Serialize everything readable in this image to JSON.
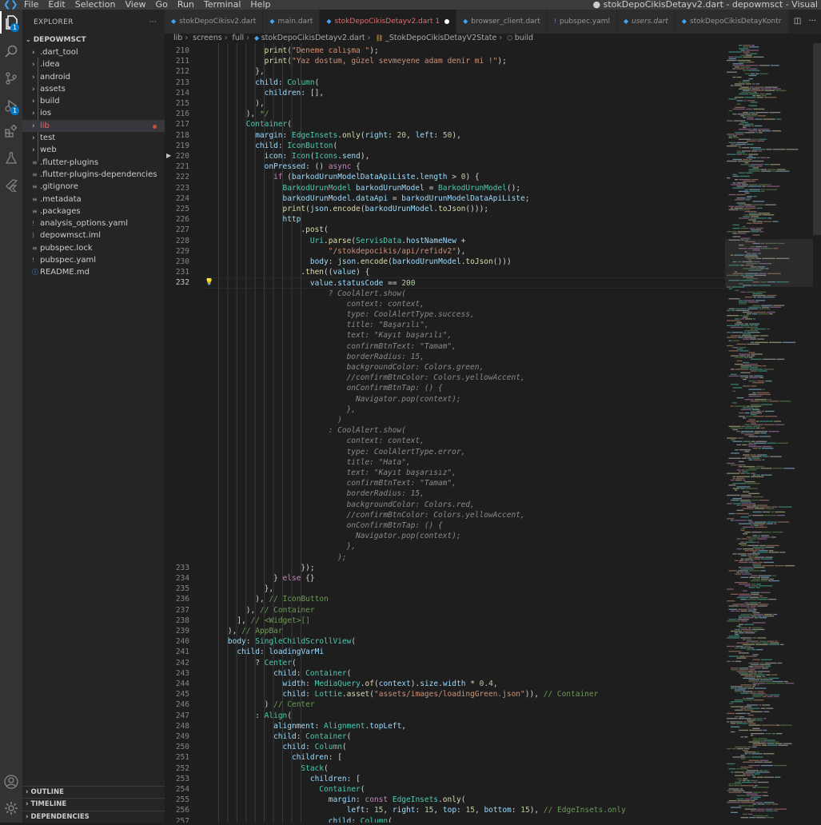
{
  "window": {
    "title": "● stokDepoCikisDetayv2.dart - depowmsct - Visual"
  },
  "menu": [
    "File",
    "Edit",
    "Selection",
    "View",
    "Go",
    "Run",
    "Terminal",
    "Help"
  ],
  "activity_bar": {
    "explorer_badge": "1",
    "run_badge": "1"
  },
  "explorer": {
    "title": "EXPLORER",
    "more": "···",
    "project": "DEPOWMSCT",
    "items": [
      {
        "label": ".dart_tool",
        "type": "folder"
      },
      {
        "label": ".idea",
        "type": "folder"
      },
      {
        "label": "android",
        "type": "folder"
      },
      {
        "label": "assets",
        "type": "folder"
      },
      {
        "label": "build",
        "type": "folder"
      },
      {
        "label": "ios",
        "type": "folder"
      },
      {
        "label": "lib",
        "type": "folder"
      },
      {
        "label": "test",
        "type": "folder"
      },
      {
        "label": "web",
        "type": "folder"
      },
      {
        "label": ".flutter-plugins",
        "type": "file"
      },
      {
        "label": ".flutter-plugins-dependencies",
        "type": "file"
      },
      {
        "label": ".gitignore",
        "type": "file"
      },
      {
        "label": ".metadata",
        "type": "file"
      },
      {
        "label": ".packages",
        "type": "file"
      },
      {
        "label": "analysis_options.yaml",
        "type": "yaml"
      },
      {
        "label": "depowmsct.iml",
        "type": "rss"
      },
      {
        "label": "pubspec.lock",
        "type": "file"
      },
      {
        "label": "pubspec.yaml",
        "type": "yaml"
      },
      {
        "label": "README.md",
        "type": "info"
      }
    ],
    "panels": [
      "OUTLINE",
      "TIMELINE",
      "DEPENDENCIES"
    ]
  },
  "tabs": [
    {
      "label": "stokDepoCikisv2.dart",
      "active": false,
      "italic": false
    },
    {
      "label": "main.dart",
      "active": false,
      "italic": false
    },
    {
      "label": "stokDepoCikisDetayv2.dart 1",
      "active": true,
      "italic": false
    },
    {
      "label": "browser_client.dart",
      "active": false,
      "italic": false
    },
    {
      "label": "pubspec.yaml",
      "active": false,
      "italic": false
    },
    {
      "label": "users.dart",
      "active": false,
      "italic": true
    },
    {
      "label": "stokDepoCikisDetayKontr",
      "active": false,
      "italic": false
    }
  ],
  "breadcrumb": [
    "lib",
    "screens",
    "full",
    "stokDepoCikisDetayv2.dart",
    "_StokDepoCikisDetayV2State",
    "build"
  ],
  "editor": {
    "current_line": 232,
    "lightbulb_line": 232,
    "fold_line": 220,
    "lines": [
      {
        "n": "210",
        "t": "            print(\"Deneme calışma \");"
      },
      {
        "n": "211",
        "t": "            print(\"Yaz dostum, güzel sevmeyene adam denir mi !\");"
      },
      {
        "n": "212",
        "t": "          },"
      },
      {
        "n": "213",
        "t": "          child: Column("
      },
      {
        "n": "214",
        "t": "            children: [],"
      },
      {
        "n": "215",
        "t": "          ),"
      },
      {
        "n": "216",
        "t": "        ), */"
      },
      {
        "n": "217",
        "t": "        Container("
      },
      {
        "n": "218",
        "t": "          margin: EdgeInsets.only(right: 20, left: 50),"
      },
      {
        "n": "219",
        "t": "          child: IconButton("
      },
      {
        "n": "220",
        "t": "            icon: Icon(Icons.send),"
      },
      {
        "n": "221",
        "t": "            onPressed: () async {"
      },
      {
        "n": "222",
        "t": "              if (barkodUrunModelDataApiListe.length > 0) {"
      },
      {
        "n": "223",
        "t": "                BarkodUrunModel barkodUrunModel = BarkodUrunModel();"
      },
      {
        "n": "224",
        "t": "                barkodUrunModel.dataApi = barkodUrunModelDataApiListe;"
      },
      {
        "n": "225",
        "t": "                print(json.encode(barkodUrunModel.toJson()));"
      },
      {
        "n": "226",
        "t": "                http"
      },
      {
        "n": "227",
        "t": "                    .post("
      },
      {
        "n": "228",
        "t": "                      Uri.parse(ServisData.hostNameNew +"
      },
      {
        "n": "229",
        "t": "                          \"/stokdepocikis/api/refidv2\"),"
      },
      {
        "n": "230",
        "t": "                      body: json.encode(barkodUrunModel.toJson()))"
      },
      {
        "n": "231",
        "t": "                    .then((value) {"
      },
      {
        "n": "232",
        "t": "                      value.statusCode == 200"
      },
      {
        "n": "",
        "t": "                          ? CoolAlert.show(",
        "inlay": true
      },
      {
        "n": "",
        "t": "                              context: context,",
        "inlay": true
      },
      {
        "n": "",
        "t": "                              type: CoolAlertType.success,",
        "inlay": true
      },
      {
        "n": "",
        "t": "                              title: \"Başarılı\",",
        "inlay": true
      },
      {
        "n": "",
        "t": "                              text: \"Kayıt başarılı\",",
        "inlay": true
      },
      {
        "n": "",
        "t": "                              confirmBtnText: \"Tamam\",",
        "inlay": true
      },
      {
        "n": "",
        "t": "                              borderRadius: 15,",
        "inlay": true
      },
      {
        "n": "",
        "t": "                              backgroundColor: Colors.green,",
        "inlay": true
      },
      {
        "n": "",
        "t": "                              //confirmBtnColor: Colors.yellowAccent,",
        "inlay": true
      },
      {
        "n": "",
        "t": "                              onConfirmBtnTap: () {",
        "inlay": true
      },
      {
        "n": "",
        "t": "                                Navigator.pop(context);",
        "inlay": true
      },
      {
        "n": "",
        "t": "                              },",
        "inlay": true
      },
      {
        "n": "",
        "t": "                            )",
        "inlay": true
      },
      {
        "n": "",
        "t": "                          : CoolAlert.show(",
        "inlay": true
      },
      {
        "n": "",
        "t": "                              context: context,",
        "inlay": true
      },
      {
        "n": "",
        "t": "                              type: CoolAlertType.error,",
        "inlay": true
      },
      {
        "n": "",
        "t": "                              title: \"Hata\",",
        "inlay": true
      },
      {
        "n": "",
        "t": "                              text: \"Kayıt başarısız\",",
        "inlay": true
      },
      {
        "n": "",
        "t": "                              confirmBtnText: \"Tamam\",",
        "inlay": true
      },
      {
        "n": "",
        "t": "                              borderRadius: 15,",
        "inlay": true
      },
      {
        "n": "",
        "t": "                              backgroundColor: Colors.red,",
        "inlay": true
      },
      {
        "n": "",
        "t": "                              //confirmBtnColor: Colors.yellowAccent,",
        "inlay": true
      },
      {
        "n": "",
        "t": "                              onConfirmBtnTap: () {",
        "inlay": true
      },
      {
        "n": "",
        "t": "                                Navigator.pop(context);",
        "inlay": true
      },
      {
        "n": "",
        "t": "                              },",
        "inlay": true
      },
      {
        "n": "",
        "t": "                            );",
        "inlay": true
      },
      {
        "n": "233",
        "t": "                    });"
      },
      {
        "n": "234",
        "t": "              } else {}"
      },
      {
        "n": "235",
        "t": "            },"
      },
      {
        "n": "236",
        "t": "          ), // IconButton"
      },
      {
        "n": "237",
        "t": "        ), // Container"
      },
      {
        "n": "238",
        "t": "      ], // <Widget>[]"
      },
      {
        "n": "239",
        "t": "    ), // AppBar"
      },
      {
        "n": "240",
        "t": "    body: SingleChildScrollView("
      },
      {
        "n": "241",
        "t": "      child: loadingVarMi"
      },
      {
        "n": "242",
        "t": "          ? Center("
      },
      {
        "n": "243",
        "t": "              child: Container("
      },
      {
        "n": "244",
        "t": "                width: MediaQuery.of(context).size.width * 0.4,"
      },
      {
        "n": "245",
        "t": "                child: Lottie.asset(\"assets/images/loadingGreen.json\")), // Container"
      },
      {
        "n": "246",
        "t": "            ) // Center"
      },
      {
        "n": "247",
        "t": "          : Align("
      },
      {
        "n": "248",
        "t": "              alignment: Alignment.topLeft,"
      },
      {
        "n": "249",
        "t": "              child: Container("
      },
      {
        "n": "250",
        "t": "                child: Column("
      },
      {
        "n": "251",
        "t": "                  children: ["
      },
      {
        "n": "252",
        "t": "                    Stack("
      },
      {
        "n": "253",
        "t": "                      children: ["
      },
      {
        "n": "254",
        "t": "                        Container("
      },
      {
        "n": "255",
        "t": "                          margin: const EdgeInsets.only("
      },
      {
        "n": "256",
        "t": "                              left: 15, right: 15, top: 15, bottom: 15), // EdgeInsets.only"
      },
      {
        "n": "257",
        "t": "                          child: Column("
      }
    ]
  },
  "colors": {
    "keyword": "#c586c0",
    "type": "#4ec9b0",
    "string": "#ce9178",
    "number": "#b5cea8",
    "property": "#9cdcfe",
    "function": "#dcdcaa",
    "comment": "#6a9955",
    "plain": "#d4d4d4",
    "inlay": "#8a8a8a",
    "accent": "#007acc"
  }
}
